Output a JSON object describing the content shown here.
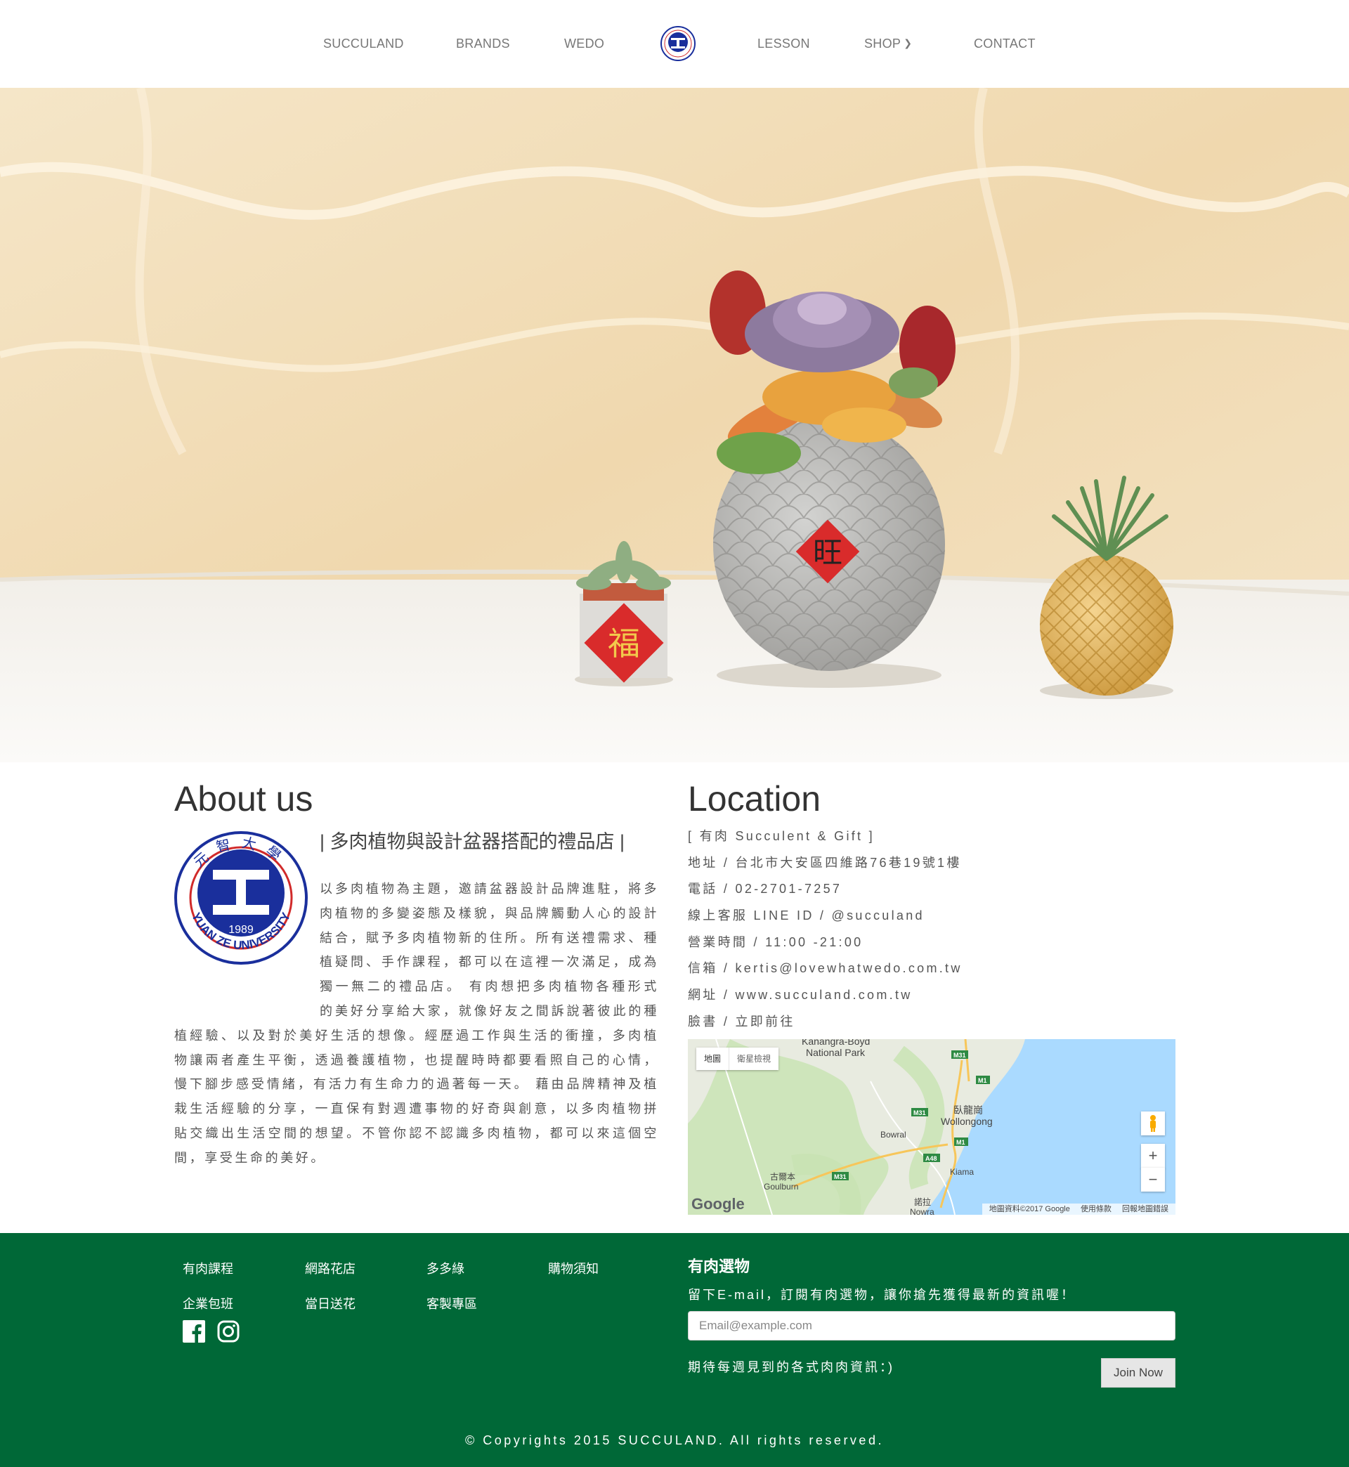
{
  "nav": {
    "items": [
      "SUCCULAND",
      "BRANDS",
      "WEDO",
      "LESSON",
      "SHOP",
      "CONTACT"
    ]
  },
  "hero": {
    "pot_left_character": "福",
    "pot_center_character": "旺"
  },
  "about": {
    "title": "About us",
    "subtitle": "| 多肉植物與設計盆器搭配的禮品店 |",
    "body": "以多肉植物為主題，邀請盆器設計品牌進駐，將多肉植物的多變姿態及樣貌，與品牌觸動人心的設計結合，賦予多肉植物新的住所。所有送禮需求、種植疑問、手作課程，都可以在這裡一次滿足，成為獨一無二的禮品店。 有肉想把多肉植物各種形式的美好分享給大家，就像好友之間訴說著彼此的種植經驗、以及對於美好生活的想像。經歷過工作與生活的衝撞，多肉植物讓兩者產生平衡，透過養護植物，也提醒時時都要看照自己的心情，慢下腳步感受情緒，有活力有生命力的過著每一天。 藉由品牌精神及植栽生活經驗的分享，一直保有對週遭事物的好奇與創意，以多肉植物拼貼交織出生活空間的想望。不管你認不認識多肉植物，都可以來這個空間，享受生命的美好。",
    "logo": {
      "year": "1989",
      "name": "YUAN ZE UNIVERSITY",
      "chinese": "元智大學"
    }
  },
  "location": {
    "title": "Location",
    "lines": [
      "[ 有肉 Succulent & Gift ]",
      "地址 / 台北市大安區四維路76巷19號1樓",
      "電話 / 02-2701-7257",
      "線上客服 LINE ID / @succuland",
      "營業時間 / 11:00 -21:00",
      "信箱 / kertis@lovewhatwedo.com.tw",
      "網址 / www.succuland.com.tw",
      "臉書 / 立即前往"
    ],
    "map": {
      "type_map": "地圖",
      "type_satellite": "衛星檢視",
      "zoom_in": "+",
      "zoom_out": "−",
      "attribution": "地圖資料©2017 Google",
      "terms": "使用條款",
      "report": "回報地圖錯誤",
      "google": "Google",
      "places": {
        "kanangra": "Kanangra-Boyd",
        "national_park": "National Park",
        "wollongong_zh": "臥龍崗",
        "wollongong": "Wollongong",
        "bowral": "Bowral",
        "kiama": "Kiama",
        "goulburn_zh": "古爾本",
        "goulburn": "Goulburn",
        "nowra_zh": "諾拉",
        "nowra": "Nowra"
      },
      "roads": [
        "M31",
        "M1",
        "M31",
        "M1",
        "A48",
        "M31"
      ]
    }
  },
  "footer": {
    "links": [
      "有肉課程",
      "網路花店",
      "多多綠",
      "購物須知",
      "企業包班",
      "當日送花",
      "客製專區"
    ],
    "newsletter": {
      "title": "有肉選物",
      "desc": "留下E-mail，訂閱有肉選物，讓你搶先獲得最新的資訊喔！",
      "placeholder": "Email@example.com",
      "hint": "期待每週見到的各式肉肉資訊：)",
      "button": "Join Now"
    },
    "copyright": "© Copyrights 2015 SUCCULAND. All rights reserved."
  },
  "colors": {
    "footer_bg": "#006837",
    "logo_blue": "#1a2f9c",
    "logo_red": "#d12a2a",
    "map_water": "#aadaff",
    "map_land": "#e8ebe0",
    "map_forest": "#c7e3b1"
  }
}
